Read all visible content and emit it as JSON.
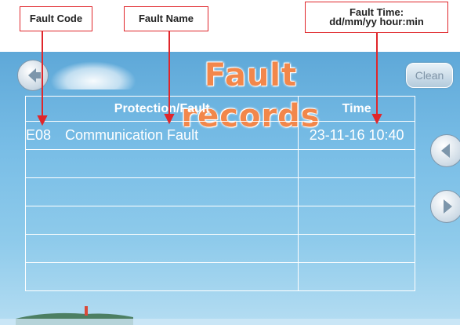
{
  "annotations": {
    "fault_code": "Fault Code",
    "fault_name": "Fault Name",
    "fault_time_line1": "Fault Time:",
    "fault_time_line2": "dd/mm/yy hour:min"
  },
  "header": {
    "title": "Fault records",
    "clean_label": "Clean",
    "back_icon": "back-arrow-icon"
  },
  "table": {
    "columns": [
      "Protection/Fault",
      "Time"
    ],
    "rows": [
      {
        "code": "E08",
        "name": "Communication Fault",
        "time": "23-11-16 10:40"
      },
      {
        "code": "",
        "name": "",
        "time": ""
      },
      {
        "code": "",
        "name": "",
        "time": ""
      },
      {
        "code": "",
        "name": "",
        "time": ""
      },
      {
        "code": "",
        "name": "",
        "time": ""
      },
      {
        "code": "",
        "name": "",
        "time": ""
      }
    ]
  },
  "navigation": {
    "prev_icon": "chevron-left-icon",
    "next_icon": "chevron-right-icon"
  },
  "colors": {
    "title": "#f2874b",
    "annotation_border": "#e0262b",
    "screen_bg": "#78bde6"
  }
}
